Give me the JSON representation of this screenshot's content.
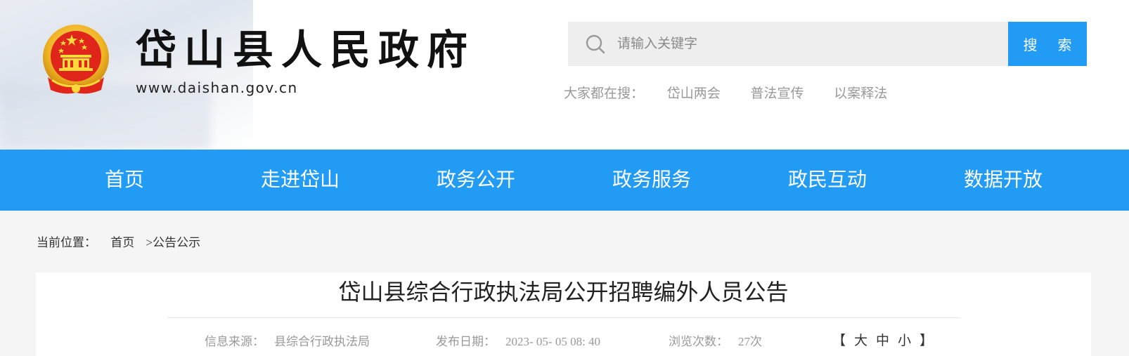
{
  "header": {
    "site_title": "岱山县人民政府",
    "site_url": "www.daishan.gov.cn",
    "emblem": "national-emblem",
    "search": {
      "placeholder": "请输入关键字",
      "button_label": "搜 索",
      "icon": "search-icon"
    },
    "hot_search": {
      "label": "大家都在搜：",
      "links": [
        "岱山两会",
        "普法宣传",
        "以案释法"
      ]
    }
  },
  "nav": {
    "items": [
      "首页",
      "走进岱山",
      "政务公开",
      "政务服务",
      "政民互动",
      "数据开放"
    ]
  },
  "breadcrumb": {
    "label": "当前位置：",
    "home": "首页",
    "current": ">公告公示"
  },
  "article": {
    "title": "岱山县综合行政执法局公开招聘编外人员公告",
    "meta": {
      "source_label": "信息来源：",
      "source_value": "县综合行政执法局",
      "date_label": "发布日期：",
      "date_value": "2023- 05- 05 08: 40",
      "views_label": "浏览次数：",
      "views_value": "27次"
    },
    "font_size": {
      "open_bracket": "【",
      "large": "大",
      "medium": "中",
      "small": "小",
      "close_bracket": "】"
    }
  },
  "colors": {
    "brand_blue": "#219bf3",
    "search_bg": "#eeeeee",
    "page_bg": "#f5f5f5"
  }
}
